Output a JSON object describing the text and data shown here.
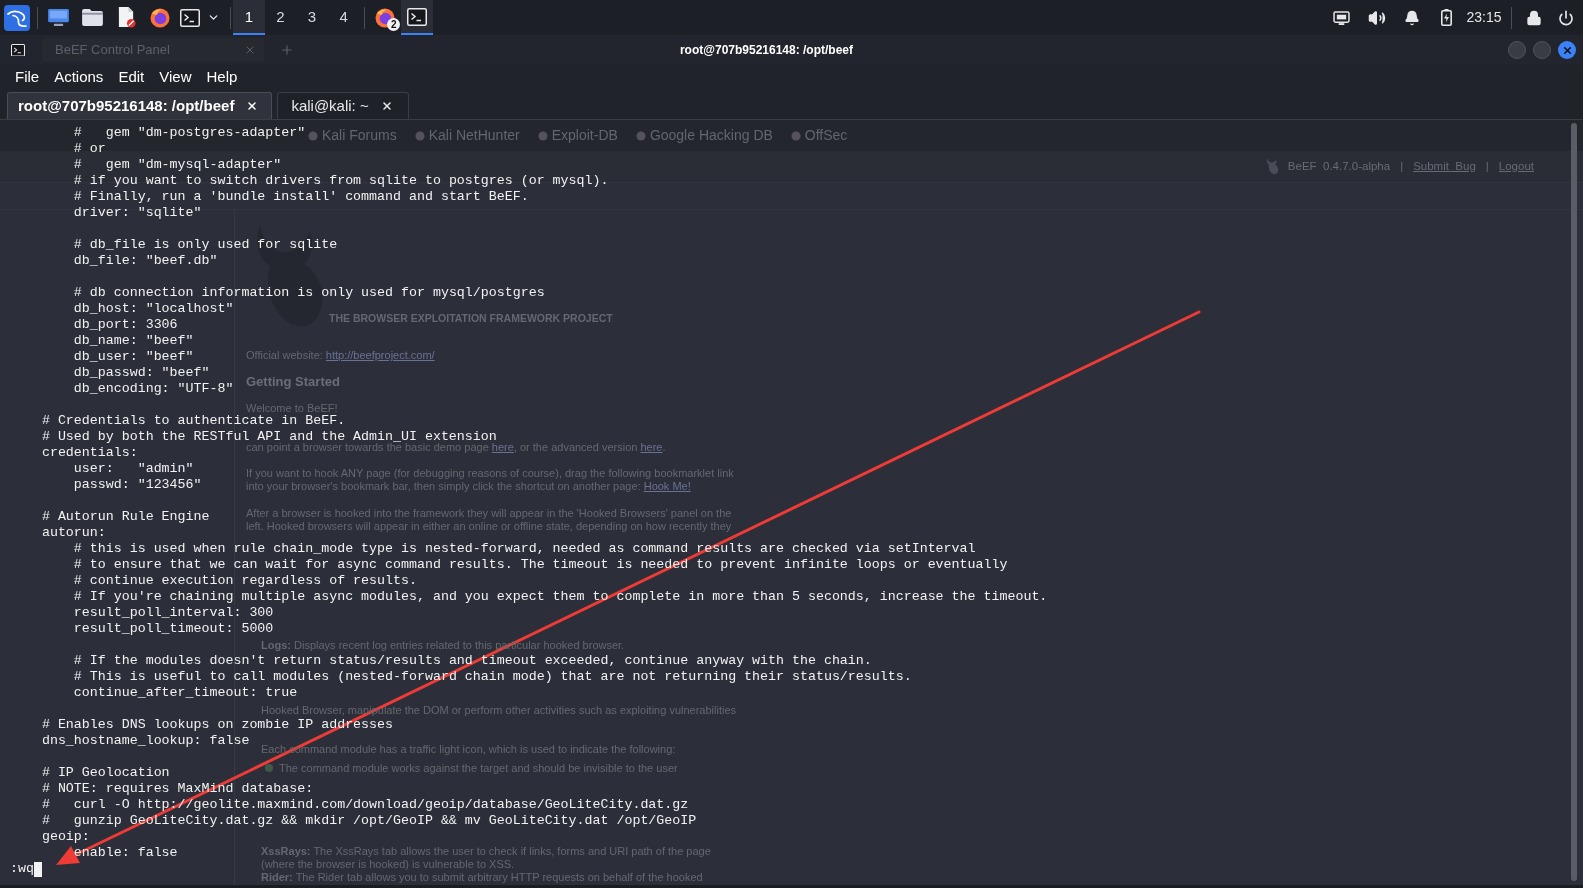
{
  "taskbar": {
    "workspaces": [
      {
        "label": "1",
        "selected": true
      },
      {
        "label": "2",
        "selected": false
      },
      {
        "label": "3",
        "selected": false
      },
      {
        "label": "4",
        "selected": false
      }
    ],
    "running_apps": [
      {
        "kind": "browser",
        "badge": "2",
        "active": false
      },
      {
        "kind": "terminal",
        "active": true
      }
    ],
    "clock": "23:15"
  },
  "browser": {
    "tab": "BeEF Control Panel",
    "bookmarks": [
      "Kali Forums",
      "Kali NetHunter",
      "Exploit-DB",
      "Google Hacking DB",
      "OffSec"
    ],
    "header": [
      {
        "kind": "label",
        "text": "BeEF  0.4.7.0-alpha"
      },
      {
        "kind": "separator",
        "text": "|"
      },
      {
        "kind": "link",
        "text": "Submit  Bug"
      },
      {
        "kind": "separator",
        "text": "|"
      },
      {
        "kind": "link",
        "text": "Logout"
      }
    ],
    "tagline": "THE BROWSER EXPLOITATION FRAMEWORK PROJECT",
    "website": {
      "label": "Official website:",
      "link": "http://beefproject.com/"
    },
    "heading": "Getting Started",
    "welcome": "Welcome to BeEF!",
    "lines": [
      {
        "kind": "text",
        "parts": [
          {
            "text": "can point a browser towards the basic demo page ",
            "link": false
          },
          {
            "text": "here",
            "link": true
          },
          {
            "text": ", or the advanced version ",
            "link": false
          },
          {
            "text": "here",
            "link": true
          },
          {
            "text": ".",
            "link": false
          }
        ]
      },
      {
        "kind": "text",
        "parts": [
          {
            "text": "If you want to hook ANY page (for debugging reasons of course), drag the following bookmarklet link",
            "link": false
          }
        ]
      },
      {
        "kind": "text",
        "parts": [
          {
            "text": "into your browser's bookmark bar, then simply click the shortcut on another page: ",
            "link": false
          },
          {
            "text": "Hook Me!",
            "link": true
          }
        ]
      },
      {
        "kind": "text",
        "parts": [
          {
            "text": "After a browser is hooked into the framework they will appear in the 'Hooked Browsers' panel on the",
            "link": false
          }
        ]
      },
      {
        "kind": "text",
        "parts": [
          {
            "text": "left. Hooked browsers will appear in either an online or offline state, depending on how recently they",
            "link": false
          }
        ]
      },
      {
        "kind": "item",
        "parts": [
          {
            "text": "**Logs:** Displays recent log entries related to this particular hooked browser.",
            "link": false
          }
        ]
      },
      {
        "kind": "item",
        "parts": [
          {
            "text": "Hooked Browser, manipulate the DOM or perform other activities such as exploiting vulnerabilities",
            "link": false
          }
        ]
      },
      {
        "kind": "item",
        "parts": [
          {
            "text": "Each command module has a traffic light icon, which is used to indicate the following:",
            "link": false
          }
        ]
      },
      {
        "kind": "bullet",
        "color": "#3f5a48",
        "parts": [
          {
            "text": "The command module works against the target and should be invisible to the user",
            "link": false
          }
        ]
      },
      {
        "kind": "item",
        "parts": [
          {
            "text": "**XssRays:** The XssRays tab allows the user to check if links, forms and URI path of the page",
            "link": false
          }
        ]
      },
      {
        "kind": "item",
        "parts": [
          {
            "text": "(where the browser is hooked) is vulnerable to XSS.",
            "link": false
          }
        ]
      },
      {
        "kind": "item",
        "parts": [
          {
            "text": "**Rider:** The Rider tab allows you to submit arbitrary HTTP requests on behalf of the hooked",
            "link": false
          }
        ]
      }
    ]
  },
  "terminal": {
    "title": "root@707b95216148: /opt/beef",
    "menu": [
      "File",
      "Actions",
      "Edit",
      "View",
      "Help"
    ],
    "tabs": [
      {
        "label": "root@707b95216148: /opt/beef",
        "selected": true
      },
      {
        "label": "kali@kali: ~",
        "selected": false
      }
    ],
    "blocks": [
      [
        "        #   gem \"dm-postgres-adapter\"",
        "        # or",
        "        #   gem \"dm-mysql-adapter\"",
        "        # if you want to switch drivers from sqlite to postgres (or mysql).",
        "        # Finally, run a 'bundle install' command and start BeEF.",
        "        driver: \"sqlite\""
      ],
      [
        "        # db_file is only used for sqlite",
        "        db_file: \"beef.db\""
      ],
      [
        "        # db connection information is only used for mysql/postgres",
        "        db_host: \"localhost\"",
        "        db_port: 3306",
        "        db_name: \"beef\"",
        "        db_user: \"beef\"",
        "        db_passwd: \"beef\"",
        "        db_encoding: \"UTF-8\""
      ],
      [
        "    # Credentials to authenticate in BeEF.",
        "    # Used by both the RESTful API and the Admin_UI extension",
        "    credentials:",
        "        user:   \"admin\"",
        "        passwd: \"123456\""
      ],
      [
        "    # Autorun Rule Engine",
        "    autorun:",
        "        # this is used when rule chain_mode type is nested-forward, needed as command results are checked via setInterval",
        "        # to ensure that we can wait for async command results. The timeout is needed to prevent infinite loops or eventually",
        "        # continue execution regardless of results.",
        "        # If you're chaining multiple async modules, and you expect them to complete in more than 5 seconds, increase the timeout.",
        "        result_poll_interval: 300",
        "        result_poll_timeout: 5000"
      ],
      [
        "        # If the modules doesn't return status/results and timeout exceeded, continue anyway with the chain.",
        "        # This is useful to call modules (nested-forward chain mode) that are not returning their status/results.",
        "        continue_after_timeout: true"
      ],
      [
        "    # Enables DNS lookups on zombie IP addresses",
        "    dns_hostname_lookup: false"
      ],
      [
        "    # IP Geolocation",
        "    # NOTE: requires MaxMind database:",
        "    #   curl -O http://geolite.maxmind.com/download/geoip/database/GeoLiteCity.dat.gz",
        "    #   gunzip GeoLiteCity.dat.gz && mkdir /opt/GeoIP && mv GeoLiteCity.dat /opt/GeoIP",
        "    geoip:",
        "        enable: false"
      ]
    ],
    "command_line": ":wq"
  }
}
